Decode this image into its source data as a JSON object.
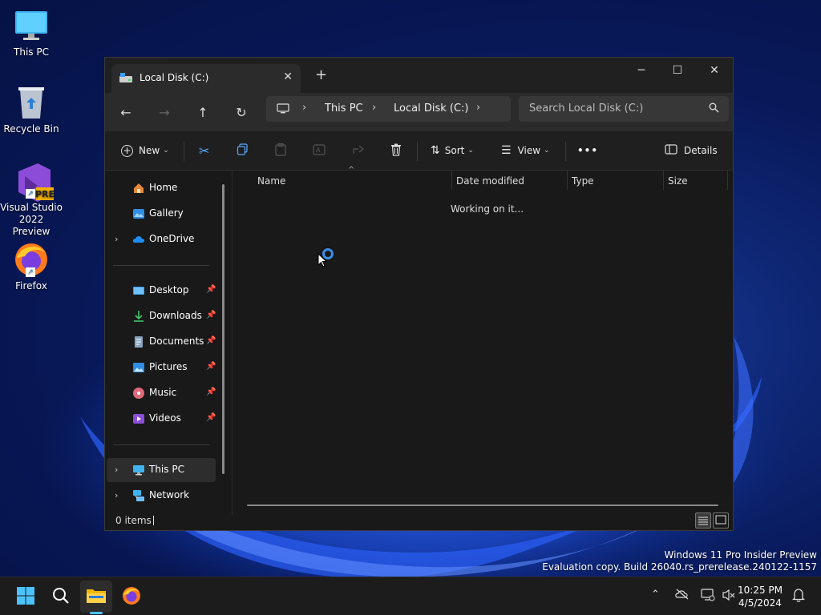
{
  "desktop": {
    "icons": [
      {
        "label": "This PC"
      },
      {
        "label": "Recycle Bin"
      },
      {
        "label": "Visual Studio 2022 Preview",
        "badge": "PRE"
      },
      {
        "label": "Firefox"
      }
    ]
  },
  "window": {
    "tab_title": "Local Disk (C:)",
    "tab_close": "✕",
    "new_tab": "+",
    "minimize": "─",
    "maximize": "☐",
    "close": "✕",
    "address": {
      "segments": [
        "This PC",
        "Local Disk (C:)"
      ]
    },
    "search_placeholder": "Search Local Disk (C:)",
    "commands": {
      "new_label": "New",
      "sort_label": "Sort",
      "view_label": "View",
      "more_label": "•••",
      "details_label": "Details"
    },
    "sidebar": {
      "items": [
        {
          "label": "Home"
        },
        {
          "label": "Gallery"
        },
        {
          "label": "OneDrive"
        },
        {
          "label": "Desktop"
        },
        {
          "label": "Downloads"
        },
        {
          "label": "Documents"
        },
        {
          "label": "Pictures"
        },
        {
          "label": "Music"
        },
        {
          "label": "Videos"
        },
        {
          "label": "This PC"
        },
        {
          "label": "Network"
        }
      ]
    },
    "columns": [
      "Name",
      "Date modified",
      "Type",
      "Size"
    ],
    "loading_text": "Working on it...",
    "status": {
      "item_count": "0 items"
    }
  },
  "watermark": {
    "line1": "Windows 11 Pro Insider Preview",
    "line2": "Evaluation copy. Build 26040.rs_prerelease.240122-1157"
  },
  "taskbar": {
    "time": "10:25 PM",
    "date": "4/5/2024"
  },
  "colors": {
    "accent": "#4cc2ff",
    "window_bg": "#191919",
    "titlebar_bg": "#202020",
    "taskbar_bg": "#1c1c1c"
  }
}
